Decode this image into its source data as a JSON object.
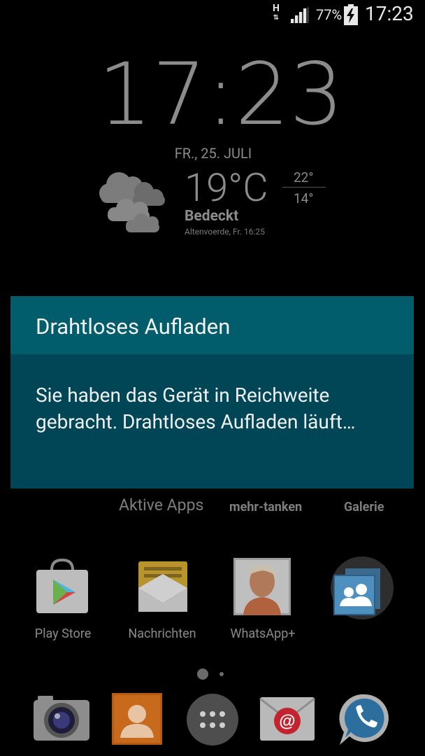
{
  "status_bar": {
    "network_type": "H",
    "battery_percent": "77%",
    "time": "17:23"
  },
  "clock_widget": {
    "time": "17:23",
    "date": "FR., 25. JULI"
  },
  "weather_widget": {
    "temperature": "19°C",
    "high": "22°",
    "low": "14°",
    "condition": "Bedeckt",
    "location_time": "Altenvoerde, Fr. 16:25"
  },
  "dialog": {
    "title": "Drahtloses Aufladen",
    "message": "Sie haben das Gerät in Reichweite gebracht. Drahtloses Aufladen läuft…"
  },
  "home_labels": {
    "active_apps": "Aktive Apps",
    "mehr_tanken": "mehr-tanken",
    "galerie": "Galerie"
  },
  "apps": [
    {
      "label": "Play Store",
      "icon": "play-store-icon"
    },
    {
      "label": "Nachrichten",
      "icon": "messages-icon"
    },
    {
      "label": "WhatsApp+",
      "icon": "contact-photo-icon"
    },
    {
      "label": "",
      "icon": "contacts-folder-icon"
    }
  ],
  "dock": [
    {
      "icon": "camera-icon"
    },
    {
      "icon": "contacts-icon"
    },
    {
      "icon": "app-drawer-icon"
    },
    {
      "icon": "email-icon"
    },
    {
      "icon": "phone-icon"
    }
  ],
  "page_indicator": {
    "pages": 2,
    "current": 1
  }
}
